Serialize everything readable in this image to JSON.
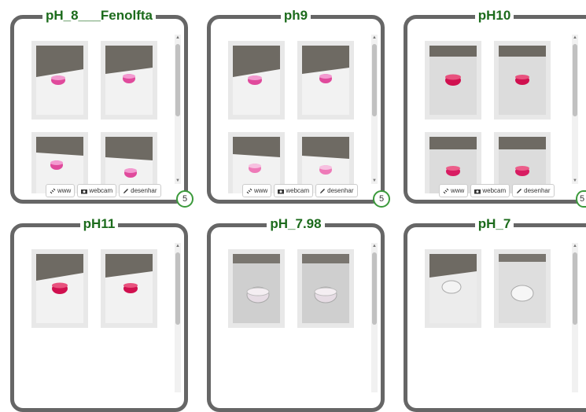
{
  "cards": [
    {
      "title": "pH_8___Fenolfta",
      "count": "5"
    },
    {
      "title": "ph9",
      "count": "5"
    },
    {
      "title": "pH10",
      "count": "5"
    },
    {
      "title": "pH11",
      "count": ""
    },
    {
      "title": "pH_7.98",
      "count": ""
    },
    {
      "title": "pH_7",
      "count": ""
    }
  ],
  "buttons": {
    "www": "www",
    "webcam": "webcam",
    "desenhar": "desenhar"
  },
  "colors": {
    "title_green": "#1c6b1c",
    "border_gray": "#666666",
    "badge_green": "#3c9a3c"
  }
}
